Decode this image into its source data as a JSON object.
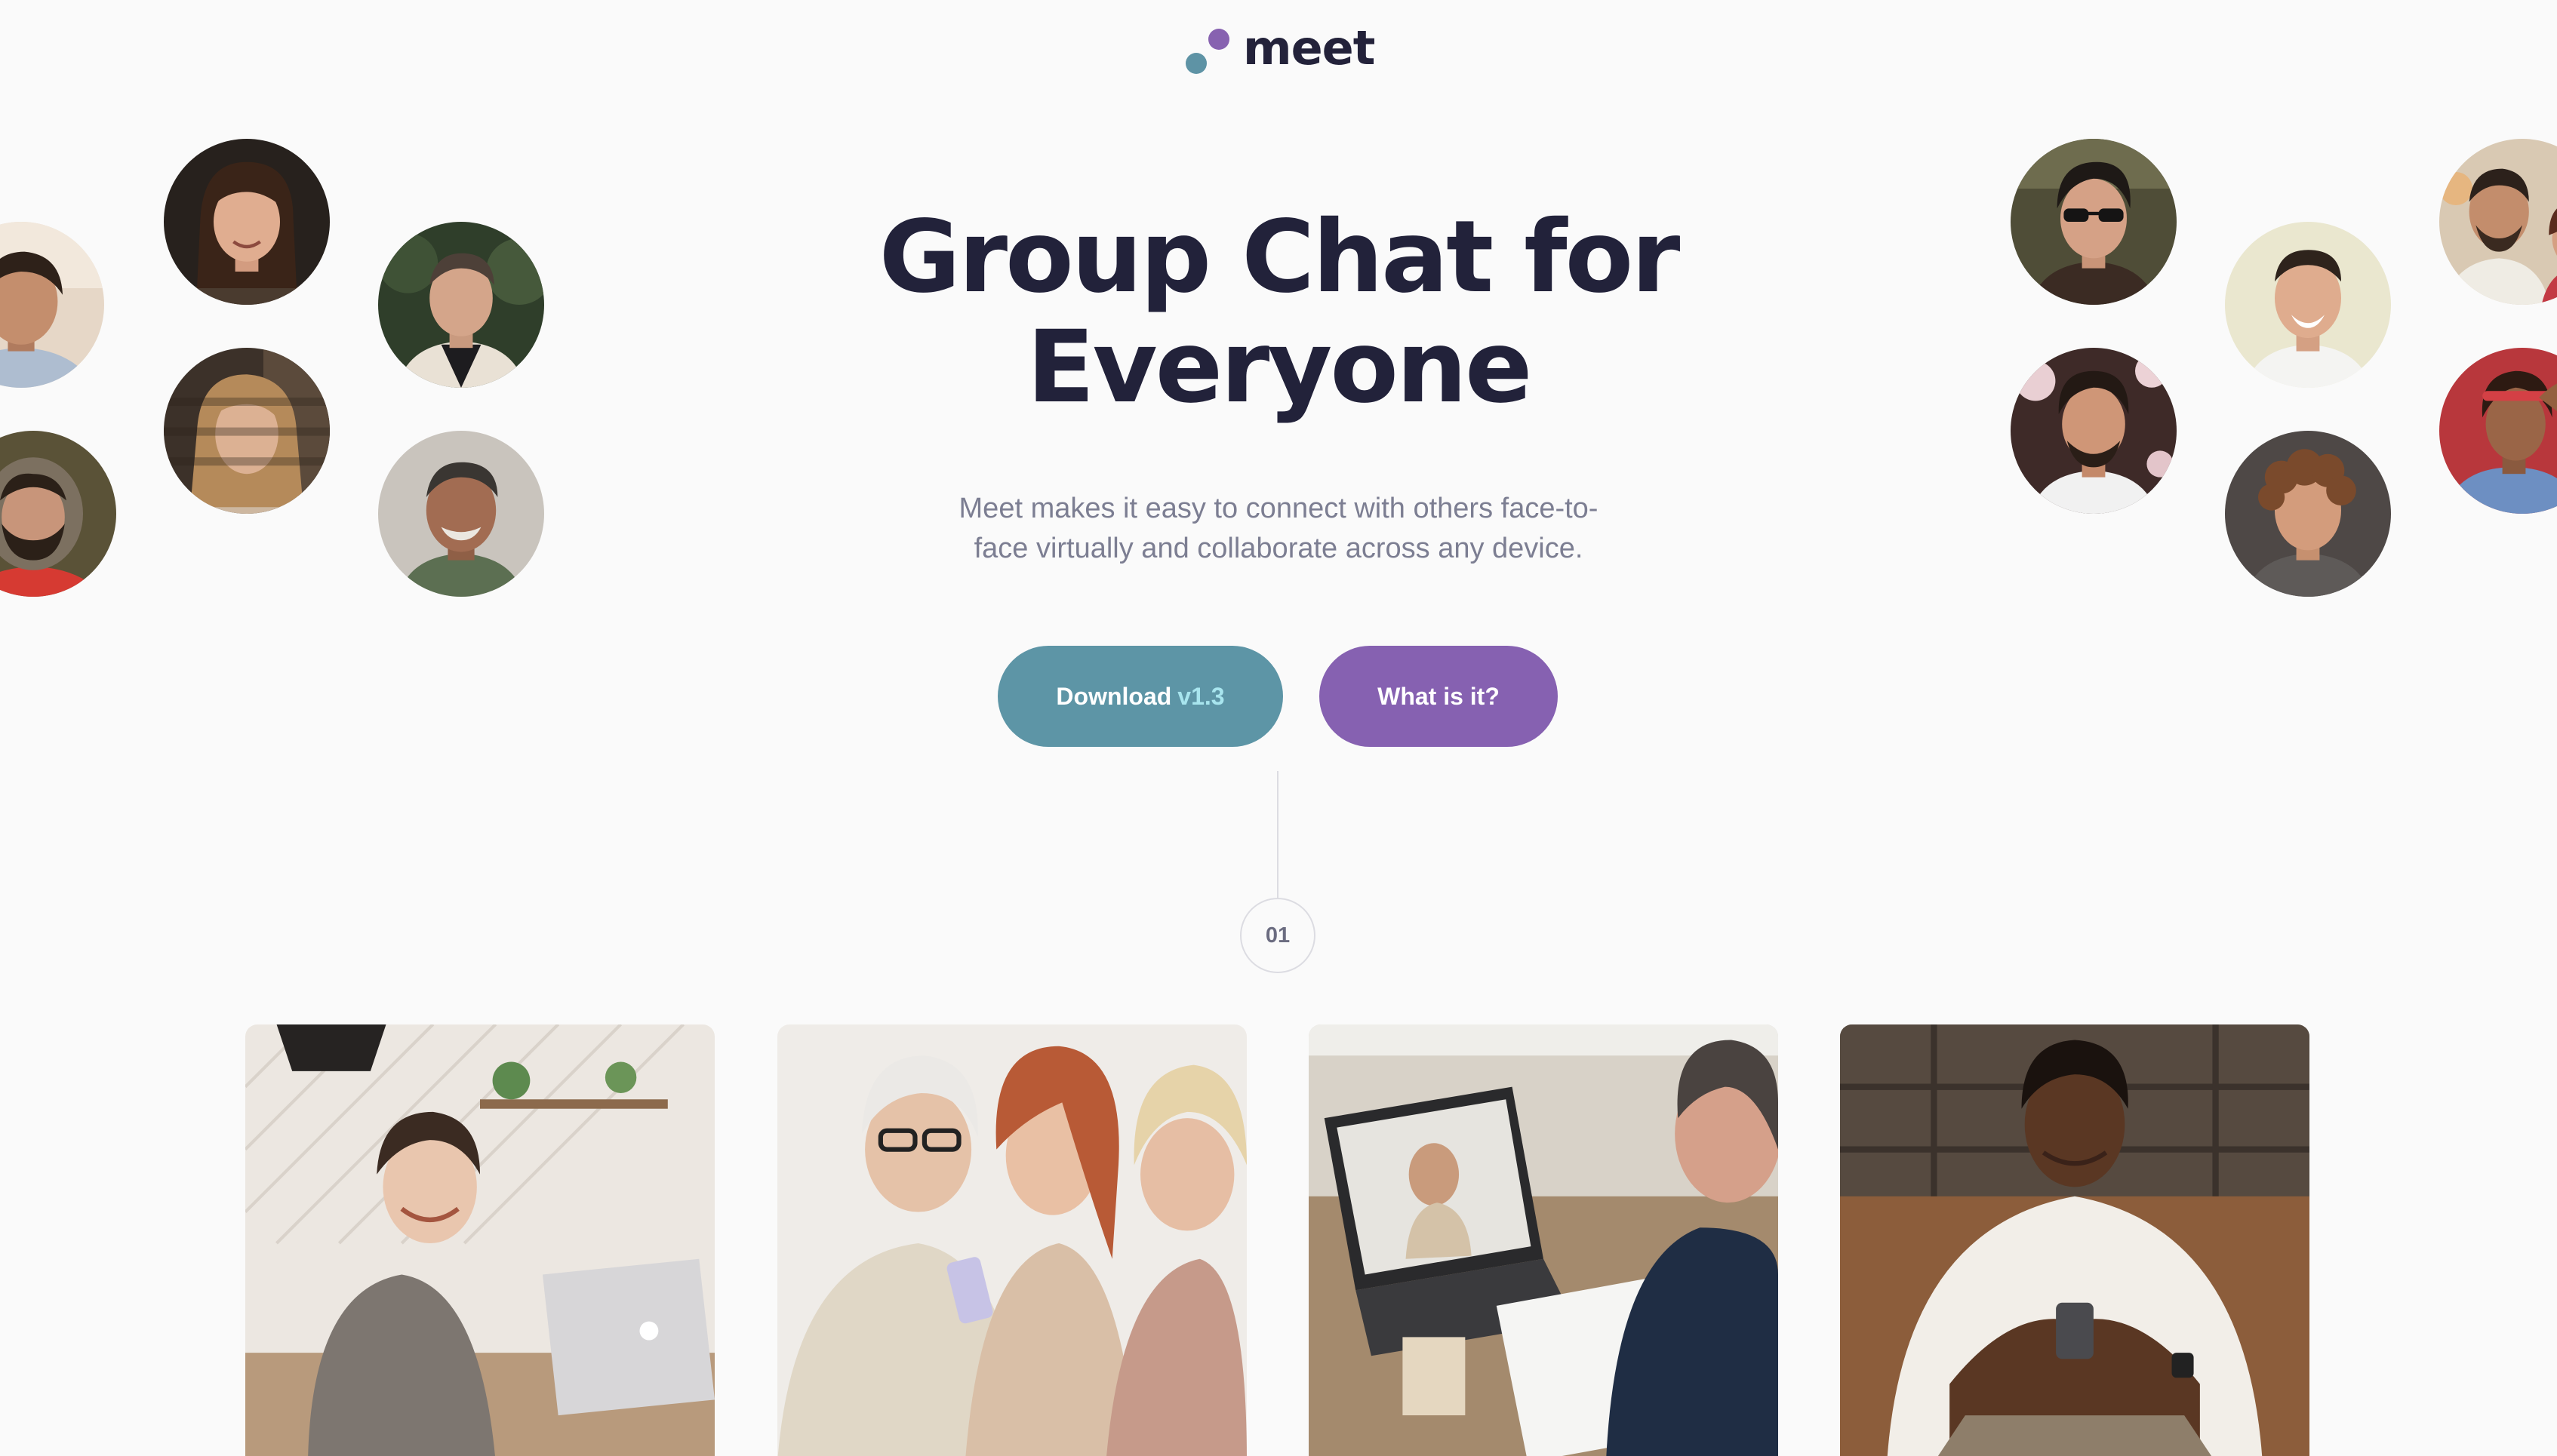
{
  "brand": {
    "name": "meet",
    "colors": {
      "primary": "#5d95a6",
      "secondary": "#8661b1",
      "heading": "#22223a",
      "body_text": "#7c7e92",
      "version_accent": "#a8e5ee"
    }
  },
  "hero": {
    "title": "Group Chat for Everyone",
    "subtitle": "Meet makes it easy to connect with others face-to-face virtually and collaborate across any device."
  },
  "actions": {
    "download": {
      "label": "Download",
      "version": "v1.3"
    },
    "about": {
      "label": "What is it?"
    }
  },
  "step": {
    "number": "01"
  },
  "avatars_left": [
    "person-portrait",
    "woman-smiling-portrait",
    "man-jacket-portrait",
    "woman-long-hair-portrait",
    "man-beard-portrait",
    "older-man-portrait"
  ],
  "avatars_right": [
    "man-sunglasses-portrait",
    "man-smiling-portrait",
    "couple-portrait",
    "young-man-portrait",
    "woman-red-headband-portrait",
    "curly-haired-man-portrait"
  ],
  "photo_cards": [
    "woman-on-laptop-call-photo",
    "women-looking-at-phone-photo",
    "man-video-call-laptop-photo",
    "man-using-phone-photo"
  ]
}
